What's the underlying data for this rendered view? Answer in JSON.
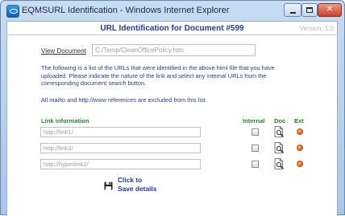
{
  "window": {
    "title": "EQMSURL Identification - Windows Internet Explorer"
  },
  "page": {
    "title": "URL Identification for Document #599",
    "version": "Version: 1.0"
  },
  "view_document": {
    "label": "View Document",
    "value": "C:/Temp/CleanOfficePolicy.htm"
  },
  "description": "The following is a list of the URLs that were identified in the above html file that you have uploaded. Please indicate the nature of the link and select any internal URLs from the corresponding document search button.",
  "note": "All mailto and http://www references are excluded from this list.",
  "columns": {
    "link": "Link information",
    "internal": "Internal",
    "doc": "Doc",
    "ext": "Ext"
  },
  "links": [
    {
      "value": "http://link1/",
      "internal": false,
      "ext_selected": true
    },
    {
      "value": "http://link3/",
      "internal": false,
      "ext_selected": true
    },
    {
      "value": "http://hyperlink2/",
      "internal": false,
      "ext_selected": true
    }
  ],
  "save": {
    "label": "Click to Save details"
  },
  "icons": {
    "app": "ie-icon",
    "doc_search": "document-search-icon",
    "save": "floppy-disk-icon"
  },
  "colors": {
    "title_blue": "#2c3c8c",
    "header_green": "#2e7d32",
    "radio_orange": "#f07a20",
    "save_blue": "#2b35a0"
  }
}
